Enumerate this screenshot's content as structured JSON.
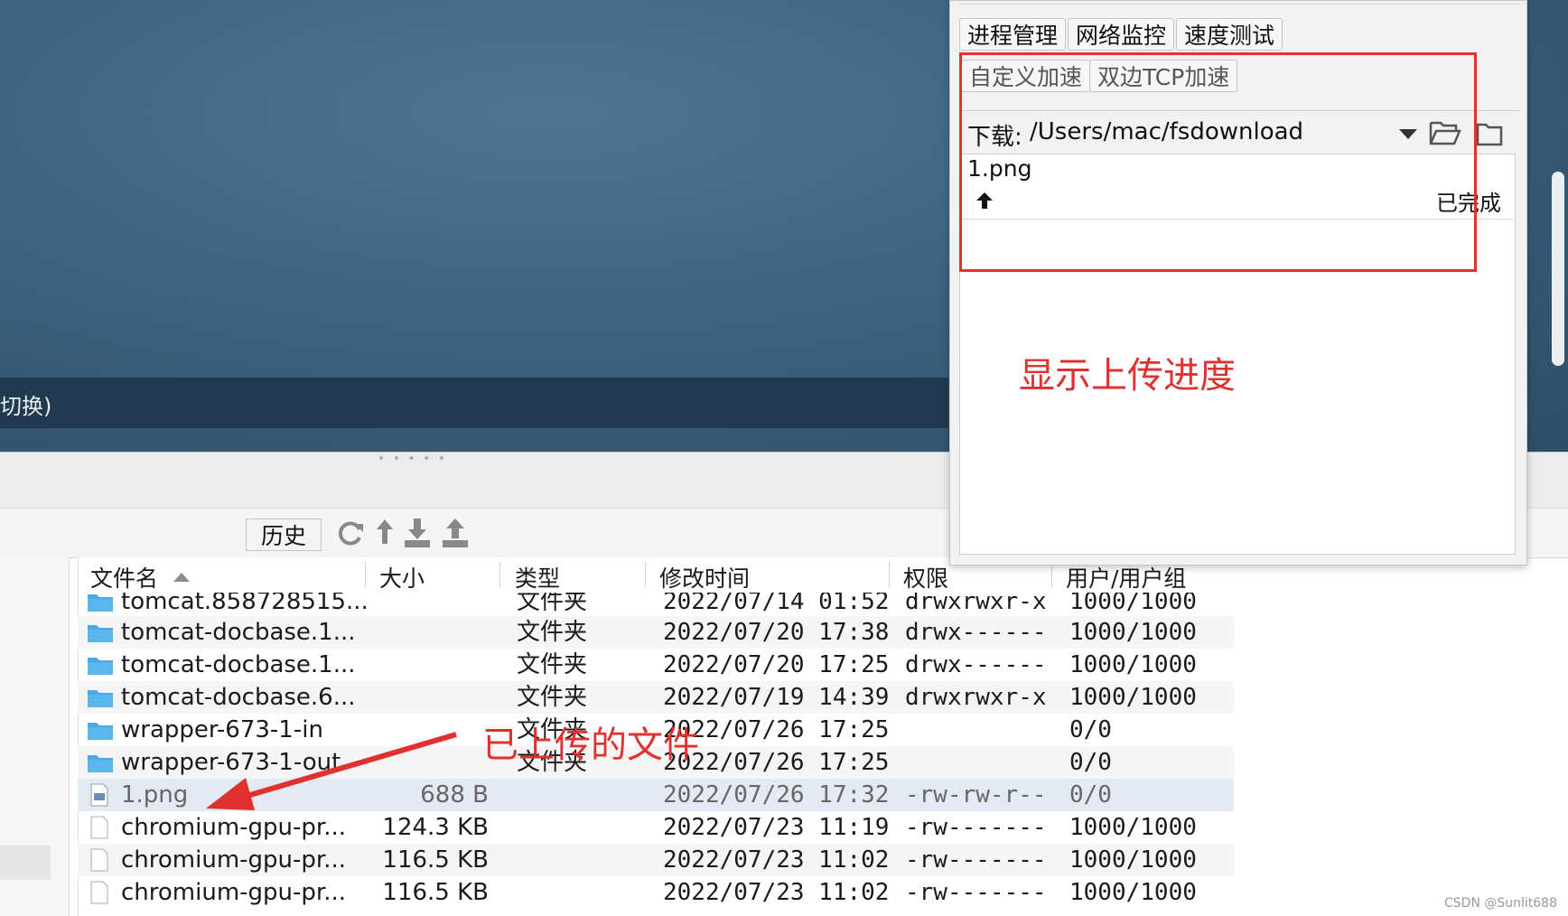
{
  "terminal": {
    "status_text": "切换)"
  },
  "toolbar": {
    "history_label": "历史"
  },
  "table": {
    "columns": [
      "文件名",
      "大小",
      "类型",
      "修改时间",
      "权限",
      "用户/用户组"
    ],
    "rows": [
      {
        "name": "tomcat.858728515...",
        "size": "",
        "type": "文件夹",
        "mtime": "2022/07/14 01:52",
        "perm": "drwxrwxr-x",
        "owner": "1000/1000",
        "icon": "folder-icon"
      },
      {
        "name": "tomcat-docbase.1...",
        "size": "",
        "type": "文件夹",
        "mtime": "2022/07/20 17:38",
        "perm": "drwx------",
        "owner": "1000/1000",
        "icon": "folder-icon"
      },
      {
        "name": "tomcat-docbase.1...",
        "size": "",
        "type": "文件夹",
        "mtime": "2022/07/20 17:25",
        "perm": "drwx------",
        "owner": "1000/1000",
        "icon": "folder-icon"
      },
      {
        "name": "tomcat-docbase.6...",
        "size": "",
        "type": "文件夹",
        "mtime": "2022/07/19 14:39",
        "perm": "drwxrwxr-x",
        "owner": "1000/1000",
        "icon": "folder-icon"
      },
      {
        "name": "wrapper-673-1-in",
        "size": "",
        "type": "文件夹",
        "mtime": "2022/07/26 17:25",
        "perm": "",
        "owner": "0/0",
        "icon": "folder-icon"
      },
      {
        "name": "wrapper-673-1-out",
        "size": "",
        "type": "文件夹",
        "mtime": "2022/07/26 17:25",
        "perm": "",
        "owner": "0/0",
        "icon": "folder-icon"
      },
      {
        "name": "1.png",
        "size": "688 B",
        "type": "",
        "mtime": "2022/07/26 17:32",
        "perm": "-rw-rw-r--",
        "owner": "0/0",
        "icon": "image-file-icon"
      },
      {
        "name": "chromium-gpu-pr...",
        "size": "124.3 KB",
        "type": "",
        "mtime": "2022/07/23 11:19",
        "perm": "-rw-------",
        "owner": "1000/1000",
        "icon": "file-icon"
      },
      {
        "name": "chromium-gpu-pr...",
        "size": "116.5 KB",
        "type": "",
        "mtime": "2022/07/23 11:02",
        "perm": "-rw-------",
        "owner": "1000/1000",
        "icon": "file-icon"
      },
      {
        "name": "chromium-gpu-pr...",
        "size": "116.5 KB",
        "type": "",
        "mtime": "2022/07/23 11:02",
        "perm": "-rw-------",
        "owner": "1000/1000",
        "icon": "file-icon"
      }
    ]
  },
  "panel": {
    "tabs": [
      "进程管理",
      "网络监控",
      "速度测试"
    ],
    "accel": [
      "自定义加速",
      "双边TCP加速"
    ],
    "download_label": "下载:",
    "download_path": "/Users/mac/fsdownload",
    "transfer": {
      "name": "1.png",
      "status": "已完成"
    }
  },
  "annotations": {
    "progress_note": "显示上传进度",
    "uploaded_note": "已上传的文件"
  },
  "watermark": "CSDN @Sunlit688",
  "colors": {
    "annotation": "#e03030",
    "folder": "#4aa8e6"
  }
}
